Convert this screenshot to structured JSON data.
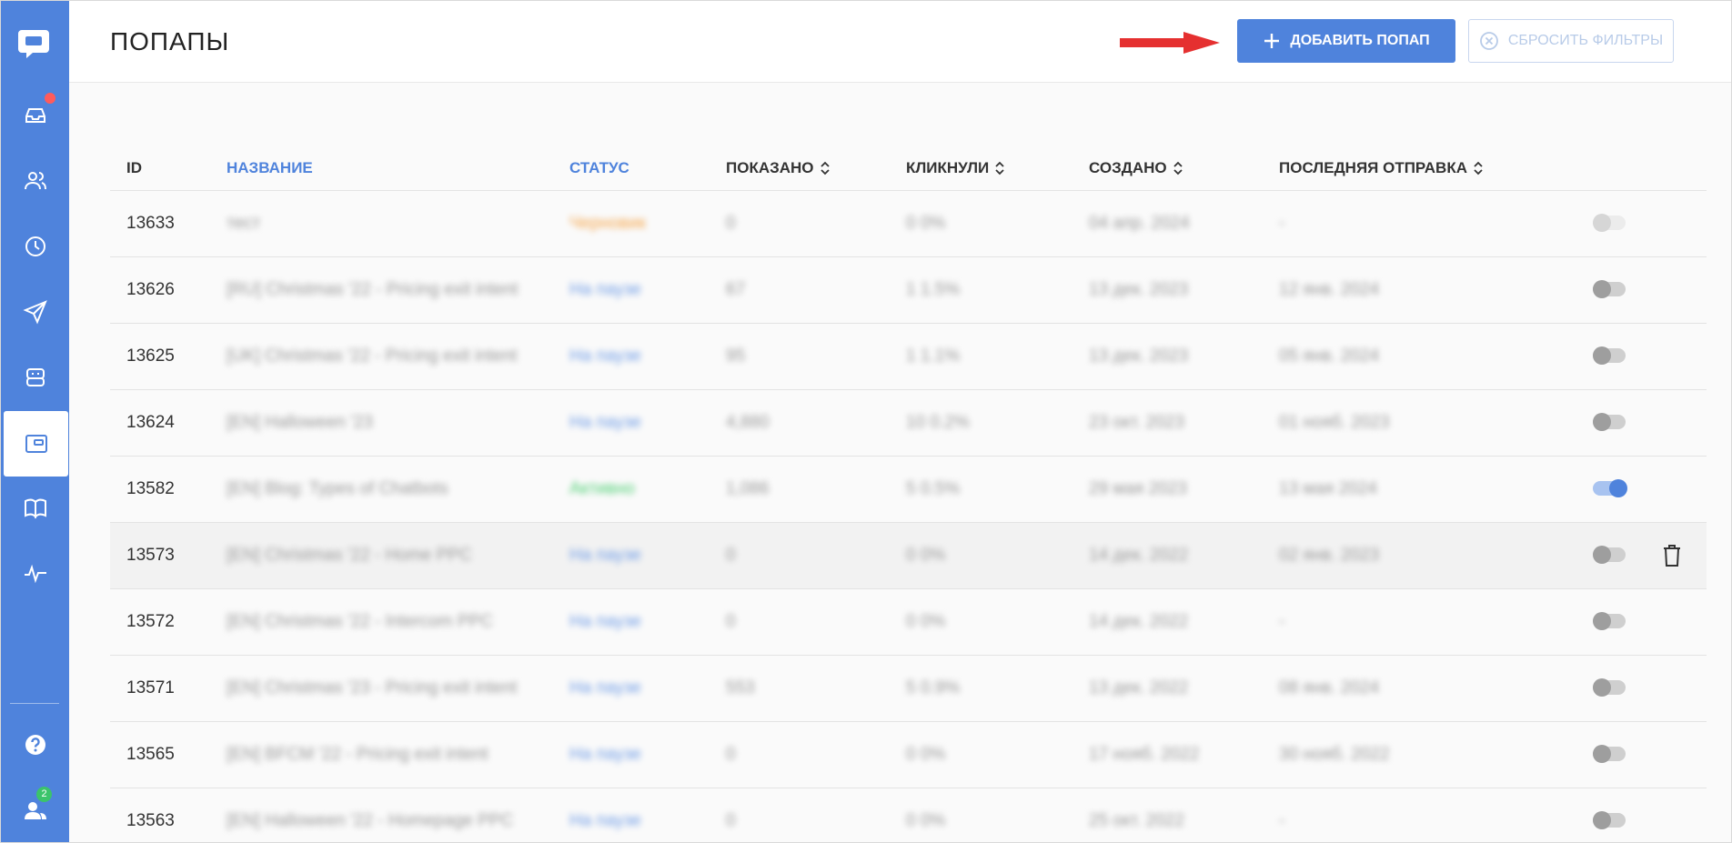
{
  "page": {
    "title": "ПОПАПЫ"
  },
  "header": {
    "add_button": "ДОБАВИТЬ ПОПАП",
    "reset_button": "СБРОСИТЬ ФИЛЬТРЫ"
  },
  "sidebar": {
    "items": [
      {
        "icon": "inbox-icon"
      },
      {
        "icon": "users-icon"
      },
      {
        "icon": "clock-icon"
      },
      {
        "icon": "send-icon"
      },
      {
        "icon": "bot-icon"
      },
      {
        "icon": "popup-icon",
        "active": true
      },
      {
        "icon": "book-icon"
      },
      {
        "icon": "activity-icon"
      },
      {
        "icon": "help-icon"
      },
      {
        "icon": "team-icon"
      }
    ],
    "team_badge": "2"
  },
  "colors": {
    "accent": "#4f83dc",
    "draft": "#f5a54a",
    "active": "#4ccf72",
    "badge": "#3bc46b"
  },
  "table": {
    "columns": {
      "id": "ID",
      "name": "НАЗВАНИЕ",
      "status": "СТАТУС",
      "shown": "ПОКАЗАНО",
      "clicked": "КЛИКНУЛИ",
      "created": "СОЗДАНО",
      "last_sent": "ПОСЛЕДНЯЯ ОТПРАВКА"
    },
    "rows": [
      {
        "id": "13633",
        "name": "тест",
        "status": "Черновик",
        "shown": "0",
        "clicked": "0 0%",
        "created": "04 апр. 2024",
        "last_sent": "-"
      },
      {
        "id": "13626",
        "name": "[RU] Christmas '22 - Pricing exit intent",
        "status": "На паузе",
        "shown": "67",
        "clicked": "1 1.5%",
        "created": "13 дек. 2023",
        "last_sent": "12 янв. 2024"
      },
      {
        "id": "13625",
        "name": "[UK] Christmas '22 - Pricing exit intent",
        "status": "На паузе",
        "shown": "95",
        "clicked": "1 1.1%",
        "created": "13 дек. 2023",
        "last_sent": "05 янв. 2024"
      },
      {
        "id": "13624",
        "name": "[EN] Halloween '23",
        "status": "На паузе",
        "shown": "4,880",
        "clicked": "10 0.2%",
        "created": "23 окт. 2023",
        "last_sent": "01 нояб. 2023"
      },
      {
        "id": "13582",
        "name": "[EN] Blog: Types of Chatbots",
        "status": "Активно",
        "shown": "1,086",
        "clicked": "5 0.5%",
        "created": "29 мая 2023",
        "last_sent": "13 мая 2024"
      },
      {
        "id": "13573",
        "name": "[EN] Christmas '22 - Home PPC",
        "status": "На паузе",
        "shown": "0",
        "clicked": "0 0%",
        "created": "14 дек. 2022",
        "last_sent": "02 янв. 2023"
      },
      {
        "id": "13572",
        "name": "[EN] Christmas '22 - Intercom PPC",
        "status": "На паузе",
        "shown": "0",
        "clicked": "0 0%",
        "created": "14 дек. 2022",
        "last_sent": "-"
      },
      {
        "id": "13571",
        "name": "[EN] Christmas '23 - Pricing exit intent",
        "status": "На паузе",
        "shown": "553",
        "clicked": "5 0.9%",
        "created": "13 дек. 2022",
        "last_sent": "08 янв. 2024"
      },
      {
        "id": "13565",
        "name": "[EN] BFCM '22 - Pricing exit intent",
        "status": "На паузе",
        "shown": "0",
        "clicked": "0 0%",
        "created": "17 нояб. 2022",
        "last_sent": "30 нояб. 2022"
      },
      {
        "id": "13563",
        "name": "[EN] Halloween '22 - Homepage PPC",
        "status": "На паузе",
        "shown": "0",
        "clicked": "0 0%",
        "created": "25 окт. 2022",
        "last_sent": "-"
      }
    ]
  }
}
